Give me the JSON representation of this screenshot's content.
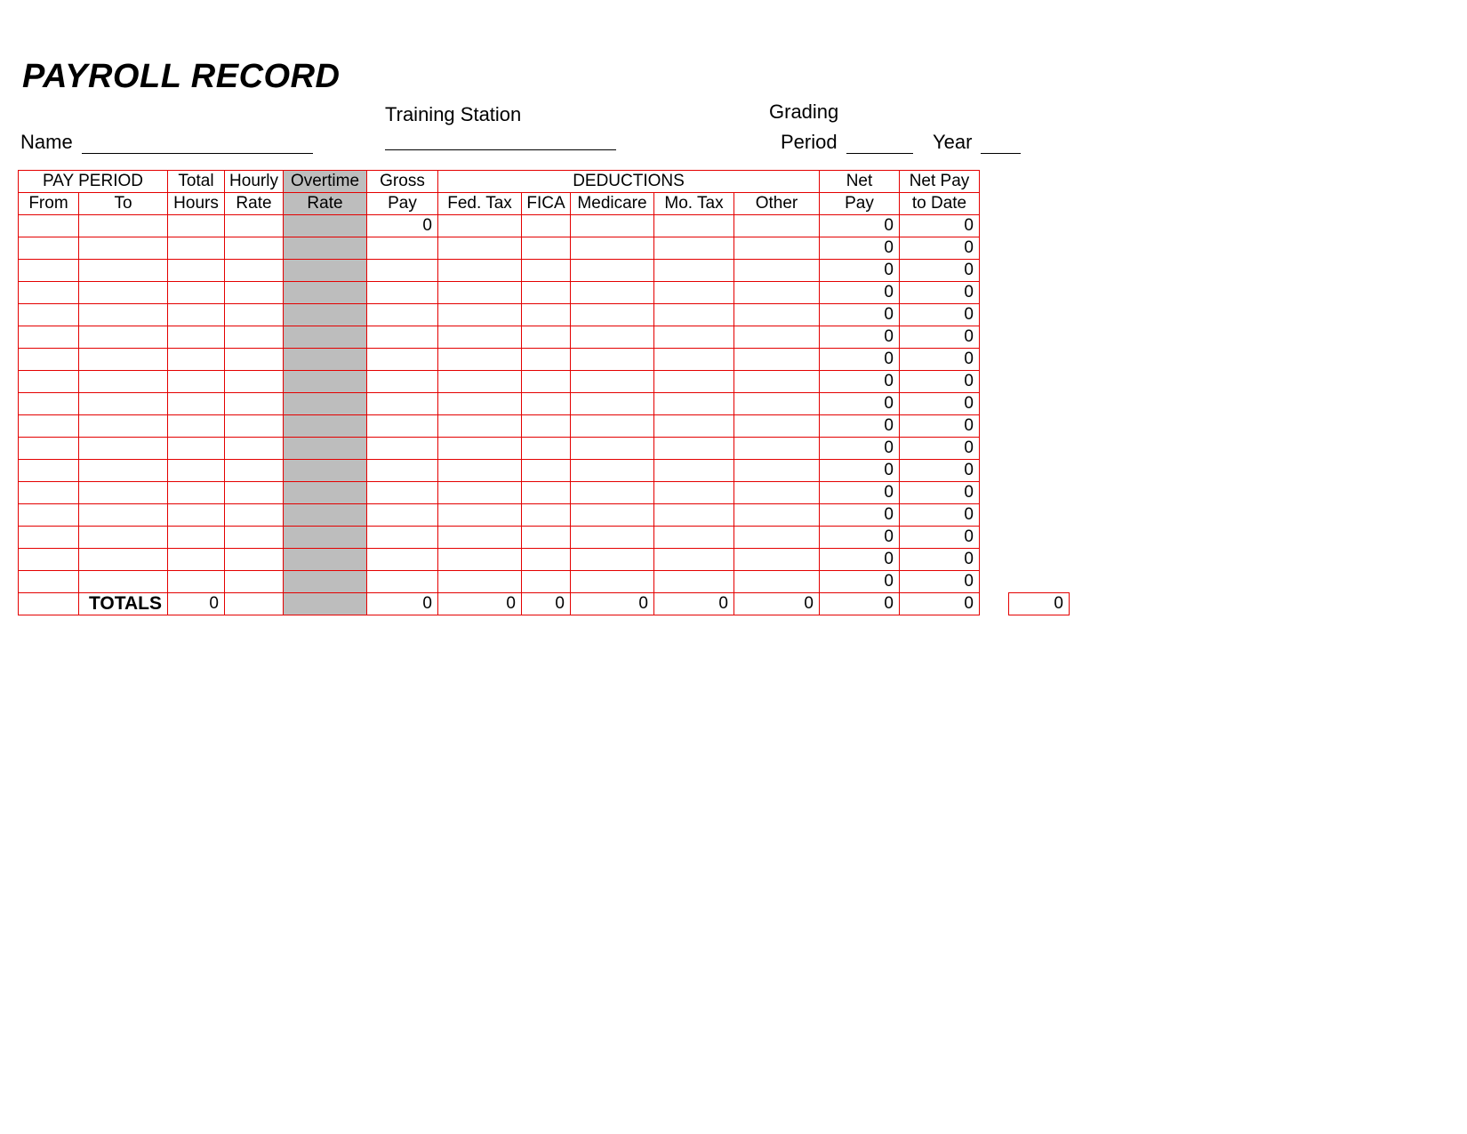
{
  "title": "PAYROLL RECORD",
  "fields": {
    "name_label": "Name",
    "station_label": "Training Station",
    "grading_label": "Grading",
    "period_label": "Period",
    "year_label": "Year"
  },
  "headers": {
    "pay_period": "PAY PERIOD",
    "from": "From",
    "to": "To",
    "total_hours_1": "Total",
    "total_hours_2": "Hours",
    "hourly_rate_1": "Hourly",
    "hourly_rate_2": "Rate",
    "overtime_rate_1": "Overtime",
    "overtime_rate_2": "Rate",
    "gross_pay_1": "Gross",
    "gross_pay_2": "Pay",
    "deductions": "DEDUCTIONS",
    "fed_tax": "Fed. Tax",
    "fica": "FICA",
    "medicare": "Medicare",
    "mo_tax": "Mo. Tax",
    "other": "Other",
    "net_pay_1": "Net",
    "net_pay_2": "Pay",
    "net_pay_to_date_1": "Net Pay",
    "net_pay_to_date_2": "to Date"
  },
  "rows": [
    {
      "gross": "0",
      "net": "0",
      "ntd": "0"
    },
    {
      "net": "0",
      "ntd": "0"
    },
    {
      "net": "0",
      "ntd": "0"
    },
    {
      "net": "0",
      "ntd": "0"
    },
    {
      "net": "0",
      "ntd": "0"
    },
    {
      "net": "0",
      "ntd": "0"
    },
    {
      "net": "0",
      "ntd": "0"
    },
    {
      "net": "0",
      "ntd": "0"
    },
    {
      "net": "0",
      "ntd": "0"
    },
    {
      "net": "0",
      "ntd": "0"
    },
    {
      "net": "0",
      "ntd": "0"
    },
    {
      "net": "0",
      "ntd": "0"
    },
    {
      "net": "0",
      "ntd": "0"
    },
    {
      "net": "0",
      "ntd": "0"
    },
    {
      "net": "0",
      "ntd": "0"
    },
    {
      "net": "0",
      "ntd": "0"
    },
    {
      "net": "0",
      "ntd": "0"
    }
  ],
  "totals": {
    "label": "TOTALS",
    "hours": "0",
    "gross": "0",
    "fed": "0",
    "fica": "0",
    "medicare": "0",
    "motax": "0",
    "other": "0",
    "net": "0",
    "ntd": "0",
    "extra": "0"
  }
}
